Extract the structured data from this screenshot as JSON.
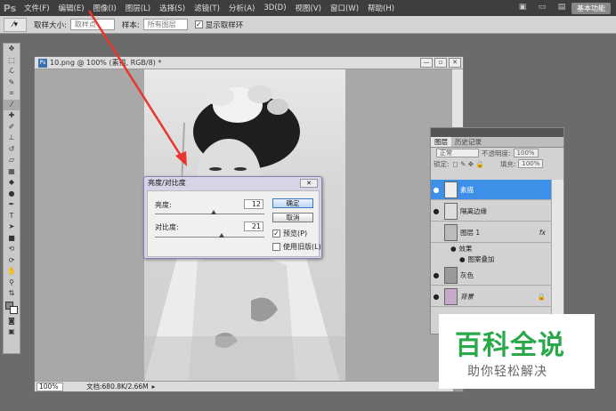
{
  "app": {
    "logo": "Ps",
    "workspace_button": "基本功能"
  },
  "menu": [
    "文件(F)",
    "编辑(E)",
    "图像(I)",
    "图层(L)",
    "选择(S)",
    "滤镜(T)",
    "分析(A)",
    "3D(D)",
    "视图(V)",
    "窗口(W)",
    "帮助(H)"
  ],
  "options_bar": {
    "sample_size_label": "取样大小:",
    "sample_size_value": "取样点",
    "sample_label": "样本:",
    "sample_value": "所有图层",
    "show_ring_label": "显示取样环",
    "show_ring_checked": true
  },
  "tools": [
    "move-icon",
    "marquee-icon",
    "lasso-icon",
    "quick-select-icon",
    "crop-icon",
    "eyedropper-icon",
    "healing-icon",
    "brush-icon",
    "stamp-icon",
    "history-brush-icon",
    "eraser-icon",
    "gradient-icon",
    "blur-icon",
    "dodge-icon",
    "pen-icon",
    "type-icon",
    "path-select-icon",
    "shape-icon",
    "3d-rotate-icon",
    "3d-orbit-icon",
    "hand-icon",
    "zoom-icon"
  ],
  "document": {
    "title": "10.png @ 100% (素描, RGB/8) *",
    "zoom": "100%",
    "info": "文档:680.8K/2.66M"
  },
  "dialog": {
    "title": "亮度/对比度",
    "brightness_label": "亮度:",
    "brightness_value": "12",
    "contrast_label": "对比度:",
    "contrast_value": "21",
    "ok_label": "确定",
    "cancel_label": "取消",
    "preview_label": "预览(P)",
    "preview_checked": true,
    "legacy_label": "使用旧版(L)",
    "legacy_checked": false,
    "close_glyph": "✕"
  },
  "layers_panel": {
    "tabs": [
      "图层",
      "历史记录"
    ],
    "blend_mode": "正常",
    "opacity_label": "不透明度:",
    "opacity_value": "100%",
    "lock_label": "锁定:",
    "fill_label": "填充:",
    "fill_value": "100%",
    "layers": [
      {
        "name": "素描",
        "visible": true,
        "selected": true
      },
      {
        "name": "隔离边缘",
        "visible": true,
        "selected": false
      },
      {
        "name": "图层 1",
        "visible": false,
        "selected": false,
        "fx": "fx"
      },
      {
        "name": "灰色",
        "visible": true,
        "selected": false
      },
      {
        "name": "背景",
        "visible": true,
        "selected": false
      }
    ],
    "effects_label": "效果",
    "pattern_overlay_label": "图案叠加"
  },
  "watermark": {
    "title": "百科全说",
    "subtitle": "助你轻松解决"
  },
  "colors": {
    "accent": "#3d8fe8",
    "annotation_arrow": "#e8362e",
    "watermark_green": "#2aa84a"
  }
}
